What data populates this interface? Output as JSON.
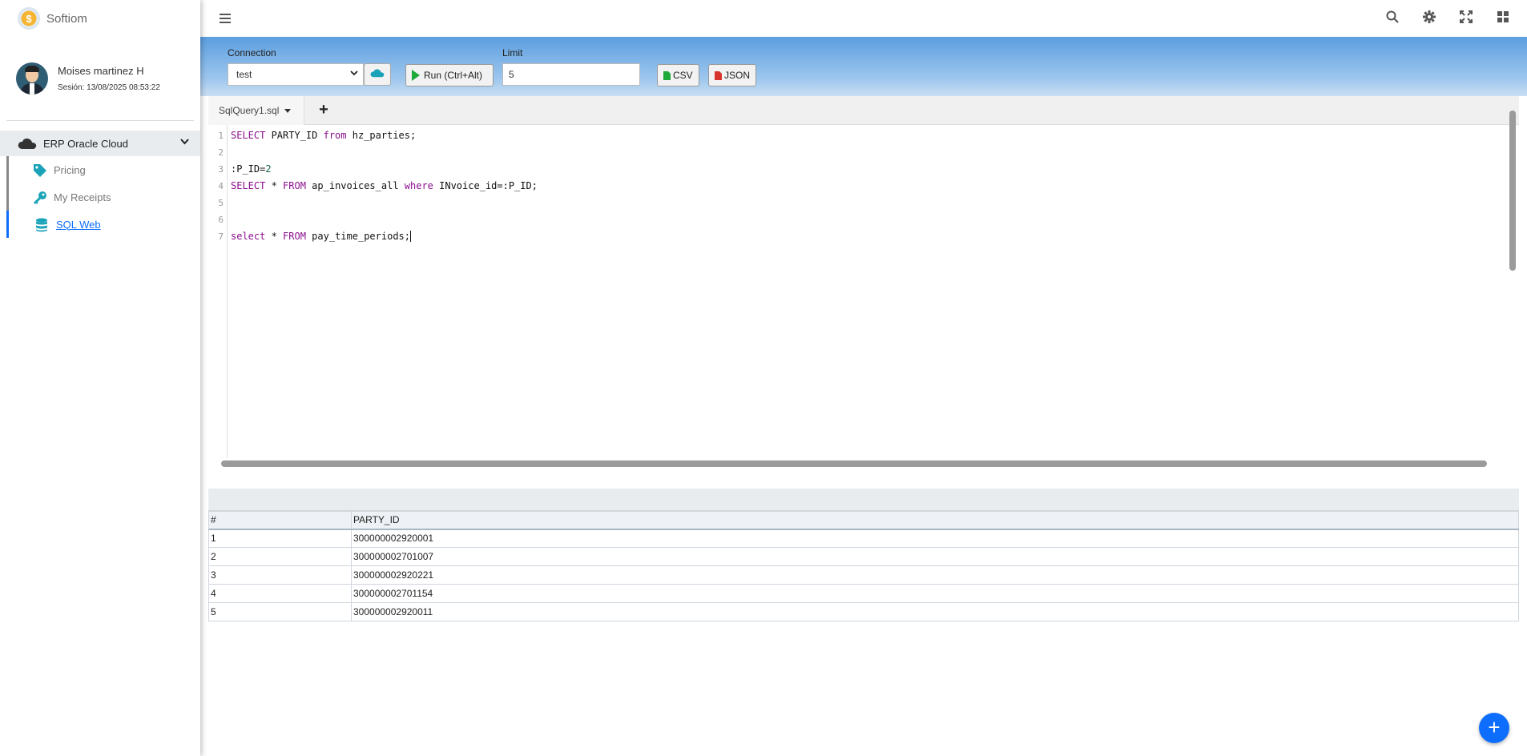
{
  "brand": {
    "name": "Softiom",
    "logo_glyph": "$"
  },
  "user": {
    "name": "Moises martinez H",
    "session": "Sesión: 13/08/2025 08:53:22"
  },
  "sidebar": {
    "group_label": "ERP Oracle Cloud",
    "items": [
      {
        "label": "Pricing",
        "icon": "tag-icon"
      },
      {
        "label": "My Receipts",
        "icon": "key-icon"
      },
      {
        "label": "SQL Web",
        "icon": "database-icon",
        "active": true
      }
    ]
  },
  "toolbar": {
    "connection_label": "Connection",
    "connection_value": "test",
    "run_label": "Run (Ctrl+Alt)",
    "limit_label": "Limit",
    "limit_value": "5",
    "csv_label": "CSV",
    "json_label": "JSON"
  },
  "editor": {
    "tab_label": "SqlQuery1.sql",
    "add_tab_glyph": "+",
    "line_numbers": [
      "1",
      "2",
      "3",
      "4",
      "5",
      "6",
      "7"
    ]
  },
  "results": {
    "columns": [
      "#",
      "PARTY_ID"
    ],
    "rows": [
      [
        "1",
        "300000002920001"
      ],
      [
        "2",
        "300000002701007"
      ],
      [
        "3",
        "300000002920221"
      ],
      [
        "4",
        "300000002701154"
      ],
      [
        "5",
        "300000002920011"
      ]
    ]
  },
  "fab_glyph": "+",
  "colors": {
    "accent": "#0d6efd",
    "teal": "#1aa3b8",
    "run_green": "#1eaa3a",
    "json_red": "#d9342b",
    "keyword": "#8a0e8e"
  }
}
